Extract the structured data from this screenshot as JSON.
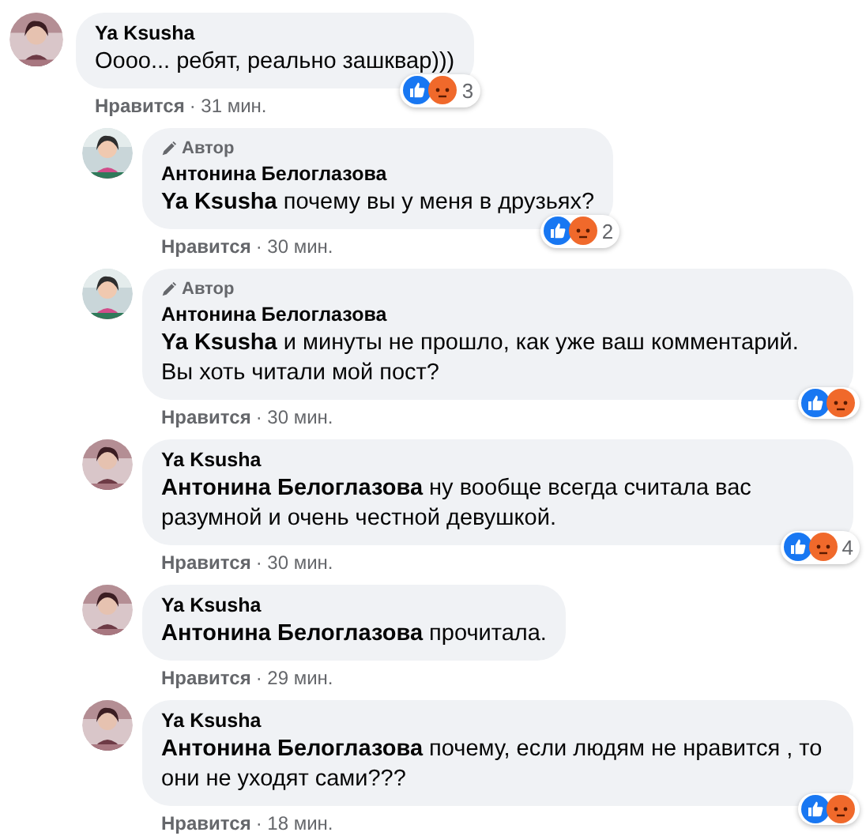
{
  "comments": [
    {
      "author": "Ya Ksusha",
      "text": "Оооо... ребят, реально зашквар)))",
      "like_label": "Нравится",
      "time": "· 31 мин.",
      "reactions": {
        "icons": [
          {
            "kind": "like"
          },
          {
            "kind": "angry"
          }
        ],
        "count": "3"
      },
      "replies": [
        {
          "badge": "Автор",
          "author": "Антонина Белоглазова",
          "mention": "Ya Ksusha",
          "text": "почему вы у меня в друзьях?",
          "like_label": "Нравится",
          "time": "· 30 мин.",
          "reactions": {
            "icons": [
              {
                "kind": "like"
              },
              {
                "kind": "angry"
              }
            ],
            "count": "2"
          }
        },
        {
          "badge": "Автор",
          "author": "Антонина Белоглазова",
          "mention": "Ya Ksusha",
          "text": "и минуты не прошло, как уже ваш комментарий. Вы хоть читали мой пост?",
          "like_label": "Нравится",
          "time": "· 30 мин.",
          "reactions": {
            "icons": [
              {
                "kind": "like"
              },
              {
                "kind": "angry"
              }
            ]
          }
        },
        {
          "author": "Ya Ksusha",
          "mention": "Антонина Белоглазова",
          "text": "ну вообще всегда считала вас разумной и очень честной девушкой.",
          "like_label": "Нравится",
          "time": "· 30 мин.",
          "reactions": {
            "icons": [
              {
                "kind": "like"
              },
              {
                "kind": "angry"
              }
            ],
            "count": "4"
          }
        },
        {
          "author": "Ya Ksusha",
          "mention": "Антонина Белоглазова",
          "text": "прочитала.",
          "like_label": "Нравится",
          "time": "· 29 мин."
        },
        {
          "author": "Ya Ksusha",
          "mention": "Антонина Белоглазова",
          "text": "почему, если людям не нравится , то они не уходят сами???",
          "like_label": "Нравится",
          "time": "· 18 мин.",
          "reactions": {
            "icons": [
              {
                "kind": "like"
              },
              {
                "kind": "angry"
              }
            ]
          }
        }
      ]
    }
  ]
}
